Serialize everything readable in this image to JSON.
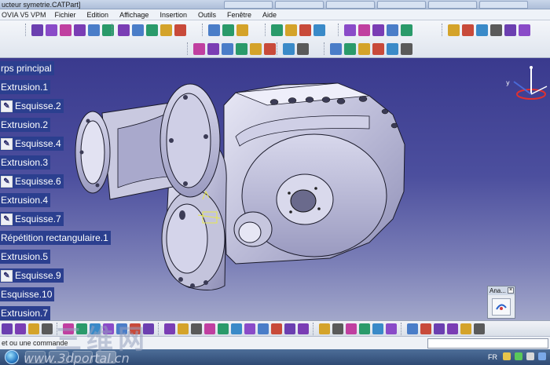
{
  "window": {
    "title": "ucteur symetrie.CATPart]"
  },
  "menubar": {
    "brand": "OVIA V5 VPM",
    "items": [
      "Fichier",
      "Edition",
      "Affichage",
      "Insertion",
      "Outils",
      "Fenêtre",
      "Aide"
    ]
  },
  "toolbar_colors": [
    "#6b3fb0",
    "#8a4bc8",
    "#c03fa0",
    "#7a3db4",
    "#4a7dc8",
    "#2a9a6a",
    "#d4a32a",
    "#c84a3a",
    "#3a8ac8",
    "#5a5a5a"
  ],
  "spec_tree": {
    "nodes": [
      {
        "label": "rps principal",
        "icon": "body-icon",
        "has_icon": false
      },
      {
        "label": "Extrusion.1",
        "icon": "pad-icon",
        "has_icon": false
      },
      {
        "label": "Esquisse.2",
        "icon": "sketch-icon",
        "has_icon": true
      },
      {
        "label": "Extrusion.2",
        "icon": "pad-icon",
        "has_icon": false
      },
      {
        "label": "Esquisse.4",
        "icon": "sketch-icon",
        "has_icon": true
      },
      {
        "label": "Extrusion.3",
        "icon": "pad-icon",
        "has_icon": false
      },
      {
        "label": "Esquisse.6",
        "icon": "sketch-icon",
        "has_icon": true
      },
      {
        "label": "Extrusion.4",
        "icon": "pad-icon",
        "has_icon": false
      },
      {
        "label": "Esquisse.7",
        "icon": "sketch-icon",
        "has_icon": true
      },
      {
        "label": "Répétition rectangulaire.1",
        "icon": "pattern-icon",
        "has_icon": false
      },
      {
        "label": "Extrusion.5",
        "icon": "pad-icon",
        "has_icon": false
      },
      {
        "label": "Esquisse.9",
        "icon": "sketch-icon",
        "has_icon": true
      },
      {
        "label": "Esquisse.10",
        "icon": "sketch-icon",
        "has_icon": false
      },
      {
        "label": "Extrusion.7",
        "icon": "pad-icon",
        "has_icon": false
      }
    ]
  },
  "palette": {
    "title": "Ana..."
  },
  "status": {
    "text": "et ou une commande"
  },
  "taskbar": {
    "language": "FR"
  },
  "watermark": {
    "cn": "三维网",
    "url": "www.3dportal.cn"
  }
}
